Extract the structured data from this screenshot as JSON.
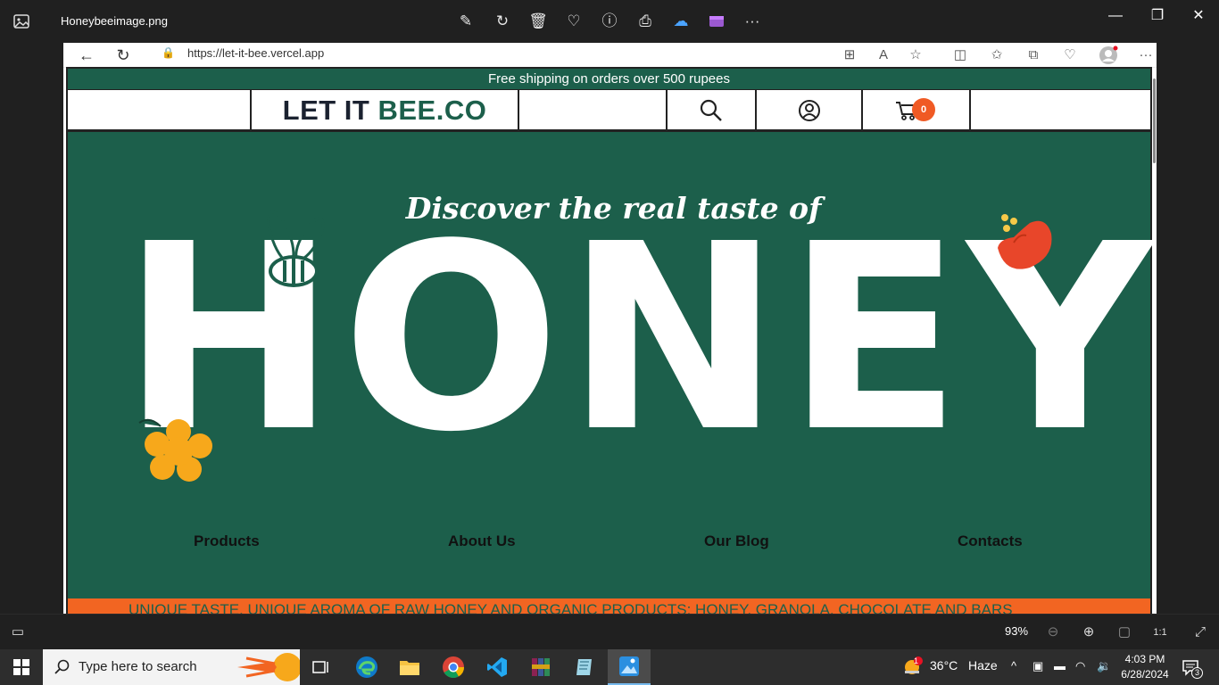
{
  "photos_viewer": {
    "file_name": "Honeybeeimage.png",
    "toolbar_icons": [
      "edit-image-icon",
      "rotate-icon",
      "delete-icon",
      "favorite-icon",
      "info-icon",
      "print-icon",
      "onedrive-icon",
      "clipchamp-icon",
      "more-icon"
    ],
    "zoom_level": "93%",
    "window_controls": {
      "minimize": "—",
      "maximize": "❐",
      "close": "✕"
    }
  },
  "browser": {
    "url": "https://let-it-bee.vercel.app"
  },
  "site": {
    "promo_bar": "Free shipping on orders over 500 rupees",
    "logo": {
      "part1": "LET IT",
      "part2": "BEE.CO"
    },
    "cart_count": "0",
    "hero": {
      "tagline": "Discover the real taste of",
      "headline": "HONEY"
    },
    "nav": [
      {
        "label": "Products"
      },
      {
        "label": "About Us"
      },
      {
        "label": "Our Blog"
      },
      {
        "label": "Contacts"
      }
    ],
    "ticker": "UNIQUE TASTE, UNIQUE AROMA OF RAW HONEY AND ORGANIC PRODUCTS: HONEY, GRANOLA, CHOCOLATE AND BARS",
    "colors": {
      "brand_green": "#1c5f4b",
      "accent_orange": "#f26522",
      "flower_yellow": "#f7a81b",
      "flower_red": "#e8462a"
    }
  },
  "taskbar": {
    "search_placeholder": "Type here to search",
    "weather": {
      "temp": "36°C",
      "condition": "Haze",
      "alert_count": "1"
    },
    "time": "4:03 PM",
    "date": "6/28/2024",
    "notification_count": "3"
  }
}
